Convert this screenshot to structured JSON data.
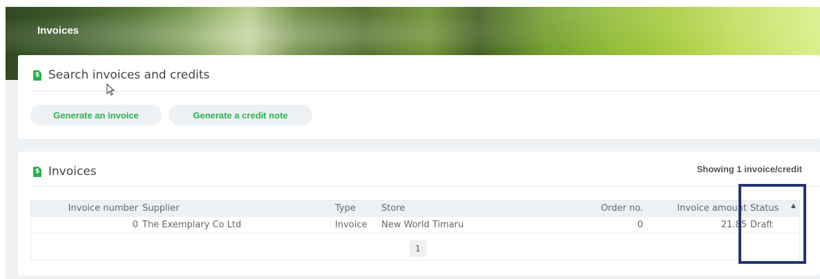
{
  "header": {
    "title": "Invoices"
  },
  "search_card": {
    "title": "Search invoices and credits",
    "buttons": [
      "Generate an invoice",
      "Generate a credit note"
    ]
  },
  "invoices_card": {
    "title": "Invoices",
    "showing": "Showing 1 invoice/credit",
    "columns": [
      "Invoice number",
      "Supplier",
      "Type",
      "Store",
      "Order no.",
      "Invoice amount",
      "Status"
    ],
    "rows": [
      {
        "invoice_number": "0",
        "supplier": "The Exemplary Co Ltd",
        "type": "Invoice",
        "store": "New World Timaru",
        "order_no": "0",
        "amount": "21.85",
        "status": "Draft"
      }
    ],
    "page": "1"
  },
  "colors": {
    "accent": "#2bb24c",
    "highlight": "#23346e"
  }
}
